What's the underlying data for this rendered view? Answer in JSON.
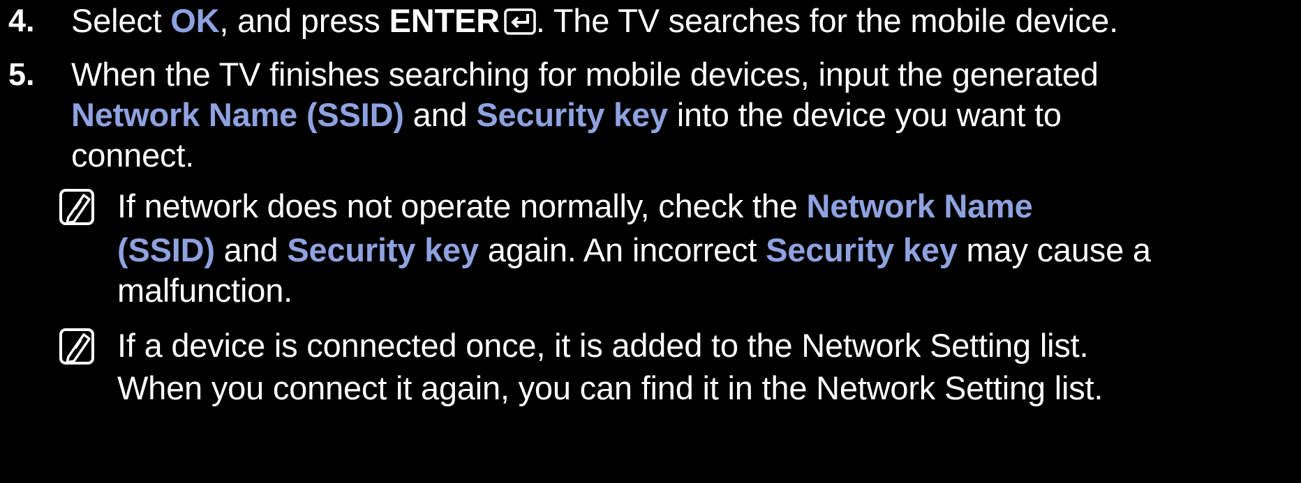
{
  "colors": {
    "background": "#000000",
    "text": "#ffffff",
    "highlight": "#8fa2e0"
  },
  "step4": {
    "number": "4.",
    "t1": "Select ",
    "ok": "OK",
    "t2": ", and press ",
    "enter": "ENTER",
    "enter_icon": "enter-key-icon",
    "t3": ". The TV searches for the mobile device."
  },
  "step5": {
    "number": "5.",
    "line1": "When the TV finishes searching for mobile devices, input the generated",
    "ssid": "Network Name (SSID)",
    "and": " and ",
    "key": "Security key",
    "t2": " into the device you want to",
    "line3": "connect."
  },
  "note1": {
    "icon": "note-icon",
    "t1": "If network does not operate normally, check the ",
    "ssid_a": "Network Name",
    "ssid_b": "(SSID)",
    "and": " and ",
    "key1": "Security key",
    "t2": " again. An incorrect ",
    "key2": "Security key",
    "t3": " may cause a",
    "line3": "malfunction."
  },
  "note2": {
    "icon": "note-icon",
    "line1": "If a device is connected once, it is added to the Network Setting list.",
    "line2": "When you connect it again, you can find it in the Network Setting list."
  }
}
